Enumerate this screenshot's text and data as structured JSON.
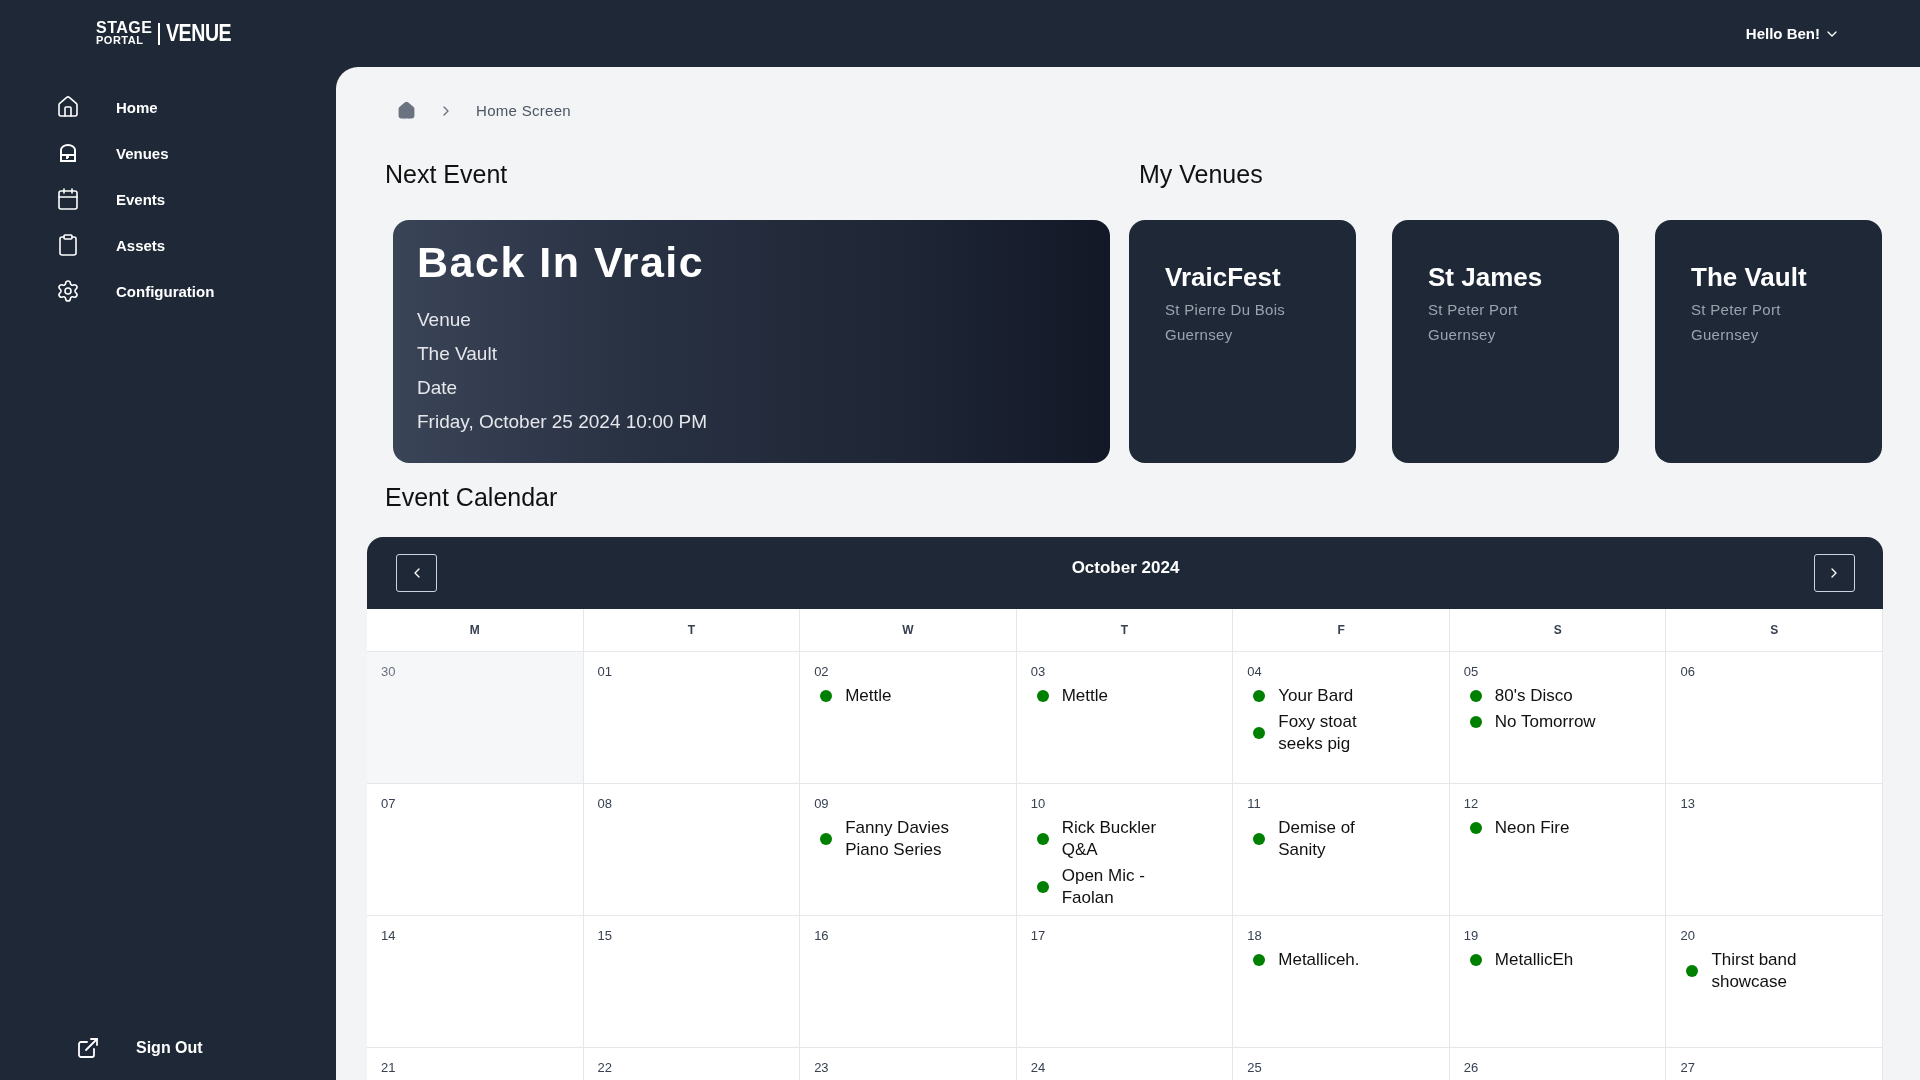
{
  "logo": {
    "line_1": "STAGE",
    "line_2": "PORTAL",
    "product": "VENUE"
  },
  "user_menu": {
    "label": "Hello Ben!"
  },
  "sidebar": {
    "items": [
      {
        "label": "Home"
      },
      {
        "label": "Venues"
      },
      {
        "label": "Events"
      },
      {
        "label": "Assets"
      },
      {
        "label": "Configuration"
      }
    ],
    "sign_out": "Sign Out"
  },
  "breadcrumb": {
    "current": "Home Screen"
  },
  "next_event": {
    "heading": "Next Event",
    "title": "Back In Vraic",
    "lines": [
      "Venue",
      "The Vault",
      "Date",
      "Friday, October 25 2024 10:00 PM"
    ]
  },
  "venues": {
    "heading": "My Venues",
    "items": [
      {
        "name": "VraicFest",
        "town": "St Pierre Du Bois",
        "island": "Guernsey"
      },
      {
        "name": "St James",
        "town": "St Peter Port",
        "island": "Guernsey"
      },
      {
        "name": "The Vault",
        "town": "St Peter Port",
        "island": "Guernsey"
      }
    ]
  },
  "calendar": {
    "heading": "Event Calendar",
    "month": "October 2024",
    "weekdays": [
      "M",
      "T",
      "W",
      "T",
      "F",
      "S",
      "S"
    ],
    "weeks": [
      [
        {
          "day": "30",
          "outside": true
        },
        {
          "day": "01",
          "outside": false
        },
        {
          "day": "02",
          "outside": false,
          "events": [
            "Mettle"
          ]
        },
        {
          "day": "03",
          "outside": false,
          "events": [
            "Mettle"
          ]
        },
        {
          "day": "04",
          "outside": false,
          "events": [
            "Your Bard",
            "Foxy stoat seeks pig"
          ]
        },
        {
          "day": "05",
          "outside": false,
          "events": [
            "80's Disco",
            "No Tomorrow"
          ]
        },
        {
          "day": "06",
          "outside": false
        }
      ],
      [
        {
          "day": "07",
          "outside": false
        },
        {
          "day": "08",
          "outside": false
        },
        {
          "day": "09",
          "outside": false,
          "events": [
            "Fanny Davies Piano Series"
          ]
        },
        {
          "day": "10",
          "outside": false,
          "events": [
            "Rick Buckler Q&A",
            "Open Mic - Faolan"
          ]
        },
        {
          "day": "11",
          "outside": false,
          "events": [
            "Demise of Sanity"
          ]
        },
        {
          "day": "12",
          "outside": false,
          "events": [
            "Neon Fire"
          ]
        },
        {
          "day": "13",
          "outside": false
        }
      ],
      [
        {
          "day": "14",
          "outside": false
        },
        {
          "day": "15",
          "outside": false
        },
        {
          "day": "16",
          "outside": false
        },
        {
          "day": "17",
          "outside": false
        },
        {
          "day": "18",
          "outside": false,
          "events": [
            "Metalliceh."
          ]
        },
        {
          "day": "19",
          "outside": false,
          "events": [
            "MetallicEh"
          ]
        },
        {
          "day": "20",
          "outside": false,
          "events": [
            "Thirst band showcase"
          ]
        }
      ],
      [
        {
          "day": "21",
          "outside": false
        },
        {
          "day": "22",
          "outside": false
        },
        {
          "day": "23",
          "outside": false
        },
        {
          "day": "24",
          "outside": false
        },
        {
          "day": "25",
          "outside": false
        },
        {
          "day": "26",
          "outside": false
        },
        {
          "day": "27",
          "outside": false
        }
      ]
    ]
  }
}
